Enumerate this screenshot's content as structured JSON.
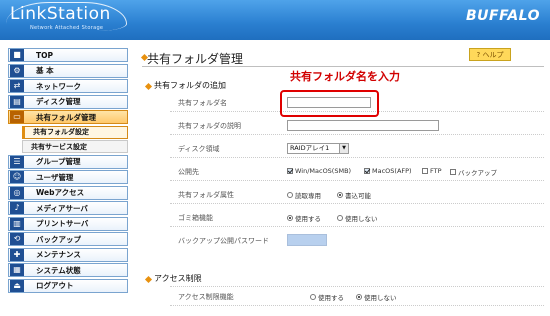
{
  "header": {
    "logo": "LinkStation",
    "logo_sub": "Network Attached Storage",
    "brand": "BUFFALO"
  },
  "sidebar": {
    "items": [
      {
        "label": "TOP",
        "icon": "top-icon"
      },
      {
        "label": "基 本",
        "icon": "basic-icon"
      },
      {
        "label": "ネットワーク",
        "icon": "network-icon"
      },
      {
        "label": "ディスク管理",
        "icon": "disk-icon"
      },
      {
        "label": "共有フォルダ管理",
        "icon": "folder-icon"
      },
      {
        "label": "グループ管理",
        "icon": "group-icon"
      },
      {
        "label": "ユーザ管理",
        "icon": "user-icon"
      },
      {
        "label": "Webアクセス",
        "icon": "web-icon"
      },
      {
        "label": "メディアサーバ",
        "icon": "media-icon"
      },
      {
        "label": "プリントサーバ",
        "icon": "printer-icon"
      },
      {
        "label": "バックアップ",
        "icon": "backup-icon"
      },
      {
        "label": "メンテナンス",
        "icon": "maintenance-icon"
      },
      {
        "label": "システム状態",
        "icon": "system-icon"
      },
      {
        "label": "ログアウト",
        "icon": "logout-icon"
      }
    ],
    "sub_items": [
      {
        "label": "共有フォルダ設定"
      },
      {
        "label": "共有サービス設定"
      }
    ]
  },
  "main": {
    "title": "共有フォルダ管理",
    "help": "? ヘルプ",
    "annotation": "共有フォルダ名を入力",
    "section_add": "共有フォルダの追加",
    "section_access": "アクセス制限",
    "fields": {
      "name_label": "共有フォルダ名",
      "name_value": "",
      "desc_label": "共有フォルダの説明",
      "desc_value": "",
      "disk_label": "ディスク領域",
      "disk_value": "RAIDアレイ1",
      "publish_label": "公開先",
      "publish_options": [
        "Win/MacOS(SMB)",
        "MacOS(AFP)",
        "FTP",
        "バックアップ"
      ],
      "attr_label": "共有フォルダ属性",
      "attr_options": [
        "読取専用",
        "書込可能"
      ],
      "trash_label": "ゴミ箱機能",
      "trash_options": [
        "使用する",
        "使用しない"
      ],
      "backup_pw_label": "バックアップ公開パスワード",
      "access_label": "アクセス制限機能",
      "access_options": [
        "使用する",
        "使用しない"
      ]
    }
  }
}
